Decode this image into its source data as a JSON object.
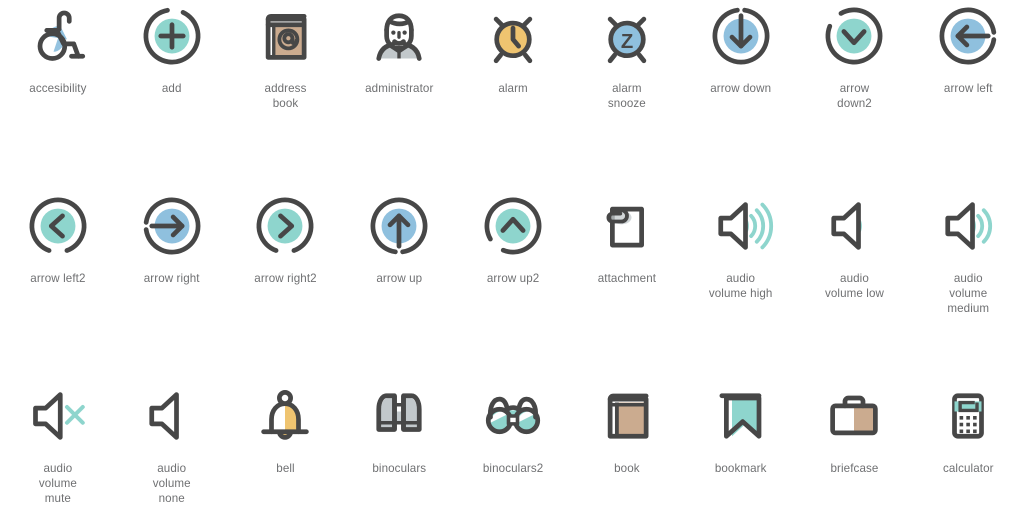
{
  "palette": {
    "stroke": "#474747",
    "teal": "#8ed5cd",
    "blue": "#8fc0de",
    "tan": "#cbab8f",
    "gold": "#efc470",
    "gray": "#c2c8cb",
    "label": "#6f7072",
    "background": "#ffffff"
  },
  "sheet": {
    "columns": 9,
    "rows": 3,
    "total_icons": 27
  },
  "icons": [
    {
      "id": "accesibility",
      "label": "accesibility",
      "accent": "blue"
    },
    {
      "id": "add",
      "label": "add",
      "accent": "teal"
    },
    {
      "id": "address-book",
      "label": "address\nbook",
      "accent": "tan"
    },
    {
      "id": "administrator",
      "label": "administrator",
      "accent": "gray"
    },
    {
      "id": "alarm",
      "label": "alarm",
      "accent": "gold"
    },
    {
      "id": "alarm-snooze",
      "label": "alarm\nsnooze",
      "accent": "blue"
    },
    {
      "id": "arrow-down",
      "label": "arrow down",
      "accent": "blue"
    },
    {
      "id": "arrow-down2",
      "label": "arrow\ndown2",
      "accent": "teal"
    },
    {
      "id": "arrow-left",
      "label": "arrow left",
      "accent": "blue"
    },
    {
      "id": "arrow-left2",
      "label": "arrow left2",
      "accent": "teal"
    },
    {
      "id": "arrow-right",
      "label": "arrow right",
      "accent": "blue"
    },
    {
      "id": "arrow-right2",
      "label": "arrow right2",
      "accent": "teal"
    },
    {
      "id": "arrow-up",
      "label": "arrow up",
      "accent": "blue"
    },
    {
      "id": "arrow-up2",
      "label": "arrow up2",
      "accent": "teal"
    },
    {
      "id": "attachment",
      "label": "attachment",
      "accent": "gray"
    },
    {
      "id": "audio-volume-high",
      "label": "audio\nvolume high",
      "accent": "teal"
    },
    {
      "id": "audio-volume-low",
      "label": "audio\nvolume low",
      "accent": "teal"
    },
    {
      "id": "audio-volume-medium",
      "label": "audio\nvolume\nmedium",
      "accent": "teal"
    },
    {
      "id": "audio-volume-mute",
      "label": "audio\nvolume\nmute",
      "accent": "teal"
    },
    {
      "id": "audio-volume-none",
      "label": "audio\nvolume\nnone",
      "accent": "none"
    },
    {
      "id": "bell",
      "label": "bell",
      "accent": "gold"
    },
    {
      "id": "binoculars",
      "label": "binoculars",
      "accent": "gray"
    },
    {
      "id": "binoculars2",
      "label": "binoculars2",
      "accent": "teal"
    },
    {
      "id": "book",
      "label": "book",
      "accent": "tan"
    },
    {
      "id": "bookmark",
      "label": "bookmark",
      "accent": "teal"
    },
    {
      "id": "briefcase",
      "label": "briefcase",
      "accent": "tan"
    },
    {
      "id": "calculator",
      "label": "calculator",
      "accent": "teal"
    }
  ]
}
